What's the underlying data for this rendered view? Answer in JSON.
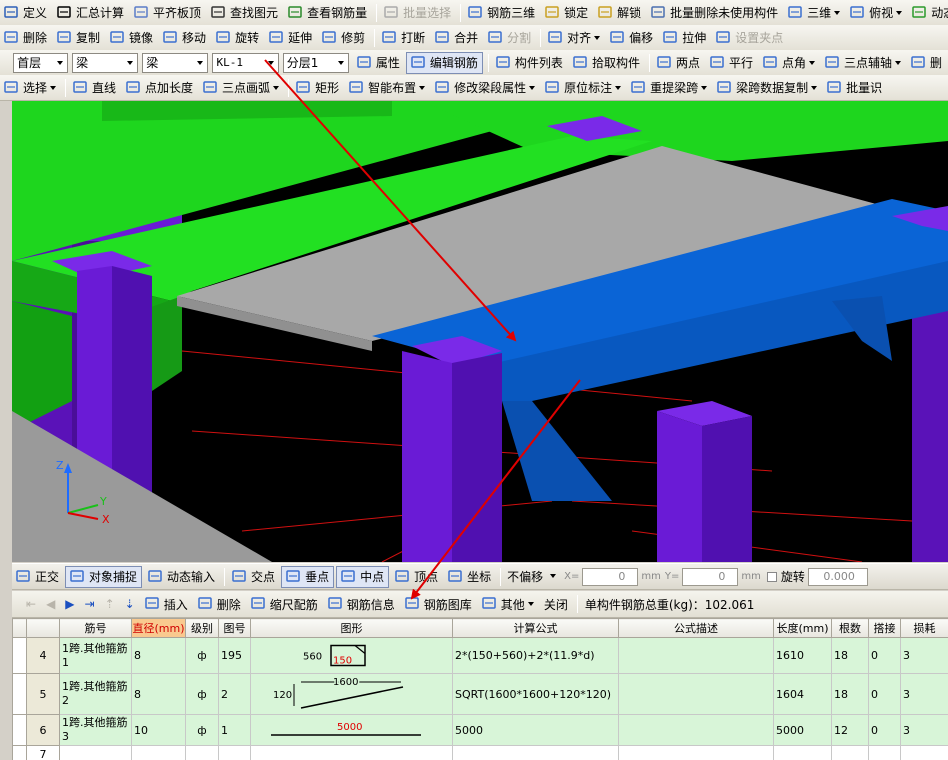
{
  "toolbar1": [
    {
      "label": "定义",
      "icon": "define-icon"
    },
    {
      "label": "汇总计算",
      "icon": "sigma-icon"
    },
    {
      "label": "平齐板顶",
      "icon": "align-slab-icon"
    },
    {
      "label": "查找图元",
      "icon": "binoculars-icon"
    },
    {
      "label": "查看钢筋量",
      "icon": "rebar-qty-icon"
    },
    {
      "label": "批量选择",
      "icon": "batch-select-icon",
      "disabled": true
    },
    {
      "label": "钢筋三维",
      "icon": "rebar-3d-icon"
    },
    {
      "label": "锁定",
      "icon": "lock-icon"
    },
    {
      "label": "解锁",
      "icon": "unlock-icon"
    },
    {
      "label": "批量删除未使用构件",
      "icon": "batch-delete-icon"
    },
    {
      "label": "三维",
      "icon": "cube-icon"
    },
    {
      "label": "俯视",
      "icon": "top-view-icon"
    },
    {
      "label": "动态观察",
      "icon": "orbit-icon"
    }
  ],
  "toolbar2": [
    {
      "label": "删除",
      "icon": "eraser-icon"
    },
    {
      "label": "复制",
      "icon": "copy-icon"
    },
    {
      "label": "镜像",
      "icon": "mirror-icon"
    },
    {
      "label": "移动",
      "icon": "move-icon"
    },
    {
      "label": "旋转",
      "icon": "rotate-icon"
    },
    {
      "label": "延伸",
      "icon": "extend-icon"
    },
    {
      "label": "修剪",
      "icon": "trim-icon"
    },
    {
      "label": "打断",
      "icon": "break-icon"
    },
    {
      "label": "合并",
      "icon": "merge-icon"
    },
    {
      "label": "分割",
      "icon": "split-icon",
      "disabled": true
    },
    {
      "label": "对齐",
      "icon": "align-icon"
    },
    {
      "label": "偏移",
      "icon": "offset-icon"
    },
    {
      "label": "拉伸",
      "icon": "stretch-icon"
    },
    {
      "label": "设置夹点",
      "icon": "grip-icon",
      "disabled": true
    }
  ],
  "toolbar3": {
    "floor": "首层",
    "category": "梁",
    "type": "梁",
    "component": "KL-1",
    "layer": "分层1",
    "buttons": [
      {
        "label": "属性",
        "icon": "property-icon"
      },
      {
        "label": "编辑钢筋",
        "icon": "edit-rebar-icon",
        "active": true
      },
      {
        "label": "构件列表",
        "icon": "list-icon"
      },
      {
        "label": "拾取构件",
        "icon": "pick-icon"
      },
      {
        "label": "两点",
        "icon": "two-point-icon"
      },
      {
        "label": "平行",
        "icon": "parallel-icon"
      },
      {
        "label": "点角",
        "icon": "point-angle-icon"
      },
      {
        "label": "三点辅轴",
        "icon": "three-point-axis-icon"
      },
      {
        "label": "删",
        "icon": "delete-axis-icon"
      }
    ]
  },
  "toolbar4": [
    {
      "label": "选择",
      "icon": "cursor-icon"
    },
    {
      "label": "直线",
      "icon": "line-icon"
    },
    {
      "label": "点加长度",
      "icon": "point-length-icon"
    },
    {
      "label": "三点画弧",
      "icon": "arc-icon"
    },
    {
      "label": "矩形",
      "icon": "rect-icon"
    },
    {
      "label": "智能布置",
      "icon": "smart-layout-icon"
    },
    {
      "label": "修改梁段属性",
      "icon": "beam-segment-icon"
    },
    {
      "label": "原位标注",
      "icon": "inplace-label-icon"
    },
    {
      "label": "重提梁跨",
      "icon": "beam-span-icon"
    },
    {
      "label": "梁跨数据复制",
      "icon": "span-copy-icon"
    },
    {
      "label": "批量识",
      "icon": "batch-identify-icon"
    }
  ],
  "axis": {
    "z": "Z",
    "y": "Y",
    "x": "X"
  },
  "statusbar": {
    "items": [
      {
        "label": "正交",
        "icon": "ortho-icon"
      },
      {
        "label": "对象捕捉",
        "icon": "snap-icon",
        "active": true
      },
      {
        "label": "动态输入",
        "icon": "dynamic-input-icon"
      },
      {
        "label": "交点",
        "icon": "intersection-icon"
      },
      {
        "label": "垂点",
        "icon": "perpendicular-icon",
        "active": true
      },
      {
        "label": "中点",
        "icon": "midpoint-icon",
        "active": true
      },
      {
        "label": "顶点",
        "icon": "vertex-icon"
      },
      {
        "label": "坐标",
        "icon": "coordinate-icon"
      }
    ],
    "offset_mode": "不偏移",
    "x_label": "X=",
    "x_value": "0",
    "y_label": "Y=",
    "y_value": "0",
    "unit_mm": "mm",
    "rotate_label": "旋转",
    "rotate_value": "0.000"
  },
  "panel_toolbar": {
    "buttons": [
      {
        "label": "插入",
        "icon": "insert-icon"
      },
      {
        "label": "删除",
        "icon": "delete-row-icon"
      },
      {
        "label": "缩尺配筋",
        "icon": "scale-rebar-icon"
      },
      {
        "label": "钢筋信息",
        "icon": "rebar-info-icon"
      },
      {
        "label": "钢筋图库",
        "icon": "rebar-library-icon"
      },
      {
        "label": "其他",
        "icon": "other-icon"
      },
      {
        "label": "关闭",
        "icon": ""
      }
    ],
    "total_weight": "单构件钢筋总重(kg)：102.061"
  },
  "table": {
    "headers": [
      "",
      "筋号",
      "直径(mm)",
      "级别",
      "图号",
      "图形",
      "计算公式",
      "公式描述",
      "长度(mm)",
      "根数",
      "搭接",
      "损耗"
    ],
    "rows": [
      {
        "num": "4",
        "name": "1跨.其他箍筋1",
        "dia": "8",
        "grade": "ф",
        "fig": "195",
        "shape": {
          "type": "stirrup",
          "a": "560",
          "b": "150"
        },
        "formula": "2*(150+560)+2*(11.9*d)",
        "desc": "",
        "length": "1610",
        "count": "18",
        "lap": "0",
        "loss": "3"
      },
      {
        "num": "5",
        "name": "1跨.其他箍筋2",
        "dia": "8",
        "grade": "ф",
        "fig": "2",
        "shape": {
          "type": "bent",
          "a": "1600",
          "b": "120"
        },
        "formula": "SQRT(1600*1600+120*120)",
        "desc": "",
        "length": "1604",
        "count": "18",
        "lap": "0",
        "loss": "3"
      },
      {
        "num": "6",
        "name": "1跨.其他箍筋3",
        "dia": "10",
        "grade": "ф",
        "fig": "1",
        "shape": {
          "type": "straight",
          "a": "5000"
        },
        "formula": "5000",
        "desc": "",
        "length": "5000",
        "count": "12",
        "lap": "0",
        "loss": "3"
      },
      {
        "num": "7",
        "name": "",
        "dia": "",
        "grade": "",
        "fig": "",
        "shape": {
          "type": "none"
        },
        "formula": "",
        "desc": "",
        "length": "",
        "count": "",
        "lap": "",
        "loss": ""
      }
    ]
  },
  "colors": {
    "accent_red": "#e00000",
    "column_purple": "#6a1bd6",
    "beam_green": "#1ed61e",
    "beam_blue": "#0a64d6",
    "slab_gray": "#a8a8a8",
    "row_green": "#d8f5d8"
  }
}
